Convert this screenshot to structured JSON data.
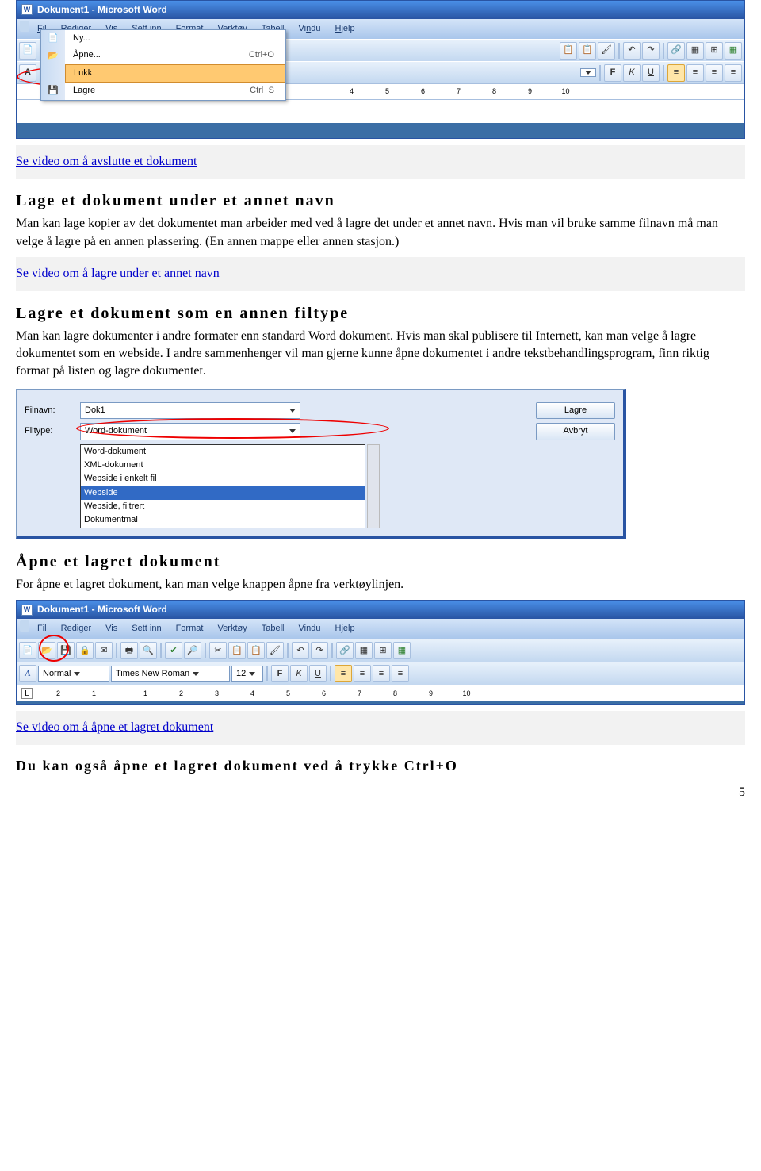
{
  "word1": {
    "title": "Dokument1 - Microsoft Word",
    "menubar": [
      "Fil",
      "Rediger",
      "Vis",
      "Sett inn",
      "Format",
      "Verktøy",
      "Tabell",
      "Vindu",
      "Hjelp"
    ],
    "file_menu": [
      {
        "label": "Ny...",
        "shortcut": ""
      },
      {
        "label": "Åpne...",
        "shortcut": "Ctrl+O"
      },
      {
        "label": "Lukk",
        "shortcut": "",
        "highlighted": true
      },
      {
        "label": "Lagre",
        "shortcut": "Ctrl+S"
      }
    ],
    "formatting": {
      "bold": "F",
      "italic": "K",
      "underline": "U"
    },
    "ruler_marks": [
      "4",
      "5",
      "6",
      "7",
      "8",
      "9",
      "10"
    ]
  },
  "links": {
    "link1": "Se video om å avslutte et dokument",
    "link2": "Se video om å lagre under et annet navn",
    "link3": "Se video om å åpne et lagret dokument"
  },
  "sections": {
    "s1_title": "Lage et dokument under et annet navn",
    "s1_body": "Man kan lage kopier av det dokumentet man arbeider med ved å lagre det under et annet navn. Hvis man vil bruke samme filnavn må man velge å lagre på en annen plassering. (En annen mappe eller annen stasjon.)",
    "s2_title": "Lagre et dokument som en annen filtype",
    "s2_body": "Man kan lagre dokumenter i andre formater enn standard Word dokument. Hvis man skal publisere til Internett, kan man velge å lagre dokumentet som en webside. I andre sammenhenger vil man gjerne kunne åpne dokumentet i andre tekstbehandlingsprogram, finn riktig format på listen og lagre dokumentet.",
    "s3_title": "Åpne et lagret dokument",
    "s3_body": "For åpne et lagret dokument, kan man velge knappen åpne fra verktøylinjen.",
    "s4_title": "Du kan også åpne et lagret dokument ved å trykke Ctrl+O"
  },
  "save_dialog": {
    "filnavn_label": "Filnavn:",
    "filnavn_value": "Dok1",
    "filtype_label": "Filtype:",
    "filtype_value": "Word-dokument",
    "lagre_btn": "Lagre",
    "avbryt_btn": "Avbryt",
    "options": [
      "Word-dokument",
      "XML-dokument",
      "Webside i enkelt fil",
      "Webside",
      "Webside, filtrert",
      "Dokumentmal"
    ]
  },
  "word2": {
    "title": "Dokument1 - Microsoft Word",
    "menubar": [
      "Fil",
      "Rediger",
      "Vis",
      "Sett inn",
      "Format",
      "Verktøy",
      "Tabell",
      "Vindu",
      "Hjelp"
    ],
    "style": "Normal",
    "font": "Times New Roman",
    "size": "12",
    "ruler_marks": [
      "2",
      "1",
      "",
      "1",
      "2",
      "3",
      "4",
      "5",
      "6",
      "7",
      "8",
      "9",
      "10"
    ]
  },
  "page_number": "5"
}
